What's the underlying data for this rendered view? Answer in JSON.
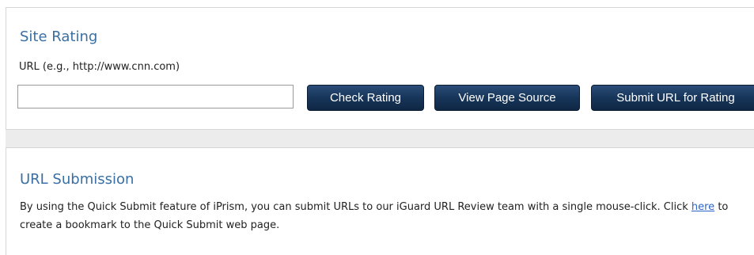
{
  "site_rating": {
    "title": "Site Rating",
    "url_label": "URL (e.g., http://www.cnn.com)",
    "url_value": "",
    "buttons": {
      "check_rating": "Check Rating",
      "view_page_source": "View Page Source",
      "submit_url": "Submit URL for Rating"
    }
  },
  "url_submission": {
    "title": "URL Submission",
    "text_before_link": "By using the Quick Submit feature of iPrism, you can submit URLs to our iGuard URL Review team with a single mouse-click. Click ",
    "link_text": "here",
    "text_after_link": " to create a bookmark to the Quick Submit web page."
  },
  "colors": {
    "title": "#3a6fa3",
    "button_bg": "#173559",
    "link": "#2d66c9",
    "band": "#ececec"
  }
}
